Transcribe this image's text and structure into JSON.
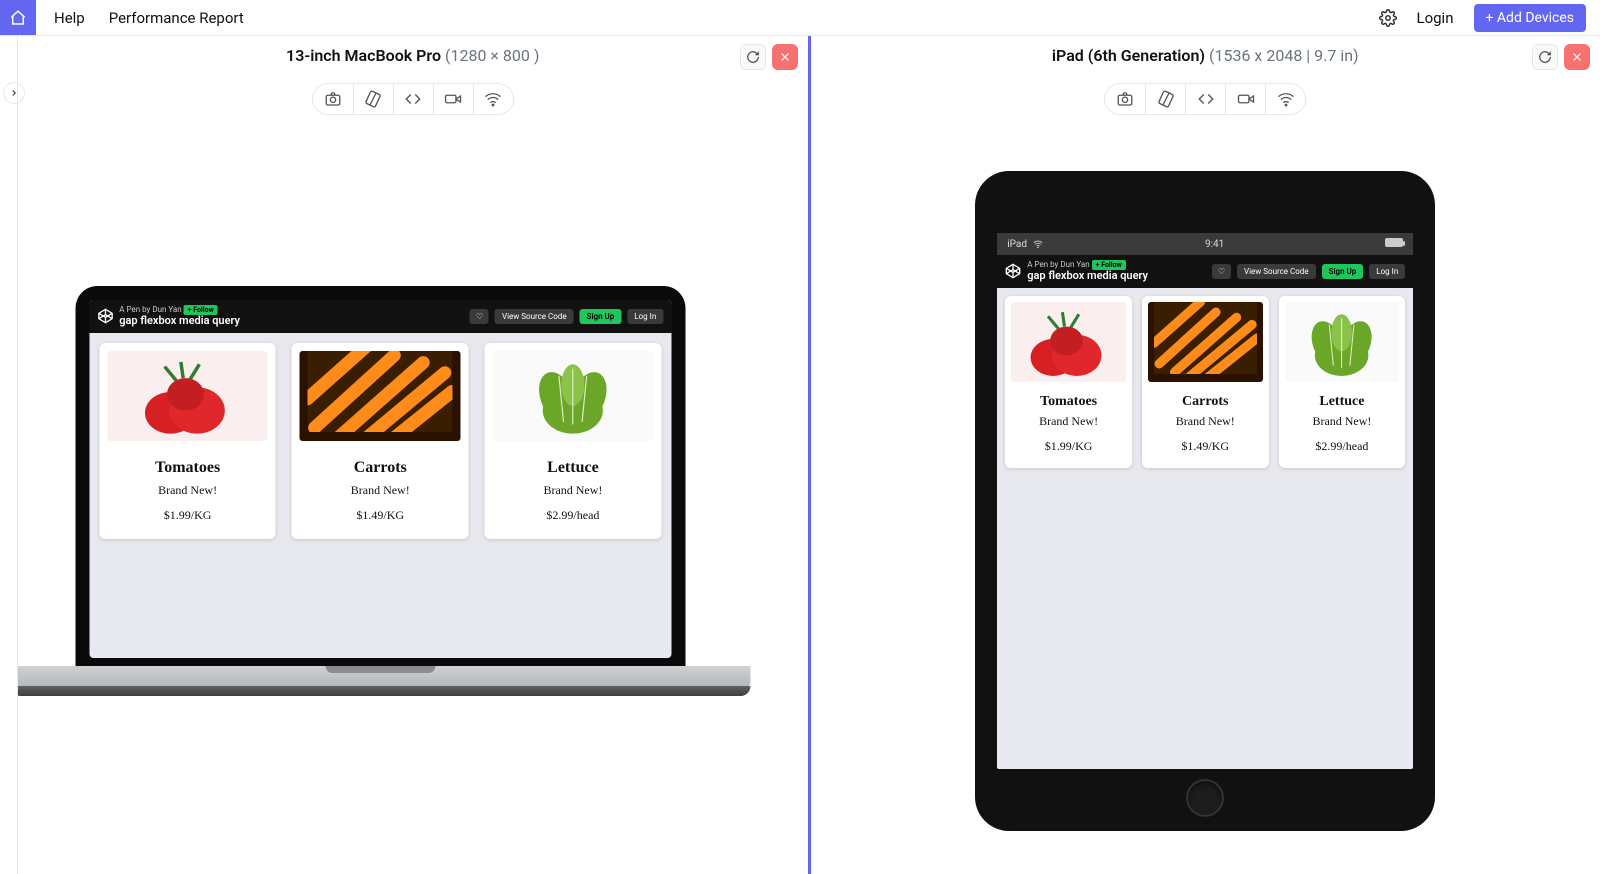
{
  "header": {
    "help": "Help",
    "performance_report": "Performance Report",
    "login": "Login",
    "add_devices": "+ Add Devices"
  },
  "panes": [
    {
      "name": "13-inch MacBook Pro",
      "dim": "(1280 × 800 )"
    },
    {
      "name": "iPad (6th Generation)",
      "dim": "(1536 x 2048 | 9.7 in)"
    }
  ],
  "codepen": {
    "byline": "A Pen by Dun Yan",
    "follow": "+ Follow",
    "title": "gap flexbox media query",
    "view_source": "View Source Code",
    "sign_up": "Sign Up",
    "log_in": "Log In",
    "heart": "♡"
  },
  "products": [
    {
      "name": "Tomatoes",
      "tag": "Brand New!",
      "price": "$1.99/KG"
    },
    {
      "name": "Carrots",
      "tag": "Brand New!",
      "price": "$1.49/KG"
    },
    {
      "name": "Lettuce",
      "tag": "Brand New!",
      "price": "$2.99/head"
    }
  ],
  "ipad_status": {
    "carrier": "iPad",
    "time": "9:41"
  }
}
